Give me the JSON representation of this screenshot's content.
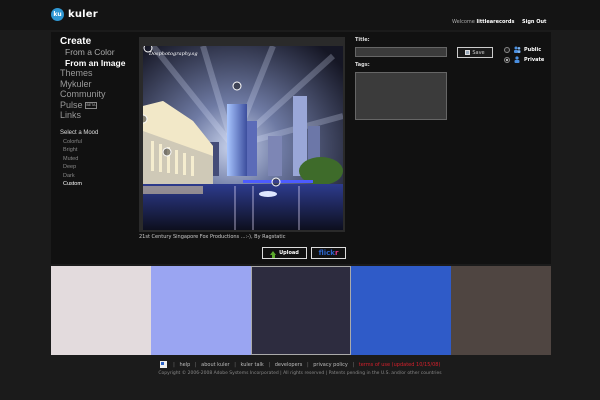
{
  "header": {
    "app_name": "kuler",
    "logo_mark": "ku",
    "welcome_prefix": "Welcome ",
    "username": "littlearecords",
    "signout_label": "Sign Out"
  },
  "nav": {
    "create_label": "Create",
    "create_items": [
      "From a Color",
      "From an Image"
    ],
    "main_items": [
      "Themes",
      "Mykuler",
      "Community",
      "Pulse",
      "Links"
    ],
    "pulse_badge": "BETA",
    "mood_title": "Select a Mood",
    "moods": [
      "Colorful",
      "Bright",
      "Muted",
      "Deep",
      "Dark",
      "Custom"
    ],
    "active_mood": "Custom"
  },
  "photo": {
    "watermark": "Dosphotography.sg",
    "caption": "21st Century Singapore Fox Productions ...:-), By Ragstatic",
    "upload_label": "Upload",
    "flickr_a": "flick",
    "flickr_b": "r"
  },
  "form": {
    "title_label": "Title:",
    "title_value": "",
    "tags_label": "Tags:",
    "tags_value": "",
    "save_label": "Save",
    "public_label": "Public",
    "private_label": "Private",
    "visibility": "Private"
  },
  "swatches": [
    {
      "color": "#e3dbdd"
    },
    {
      "color": "#9aa5f2"
    },
    {
      "color": "#2d2c3f"
    },
    {
      "color": "#2f5bc8"
    },
    {
      "color": "#4f4541"
    }
  ],
  "footer": {
    "links": [
      "help",
      "about kuler",
      "kuler talk",
      "developers",
      "privacy policy"
    ],
    "terms_label": "terms of use (updated 10/15/08)",
    "copyright": "Copyright © 2006-2008 Adobe Systems Incorporated | All rights reserved | Patents pending in the U.S. and/or other countries"
  }
}
